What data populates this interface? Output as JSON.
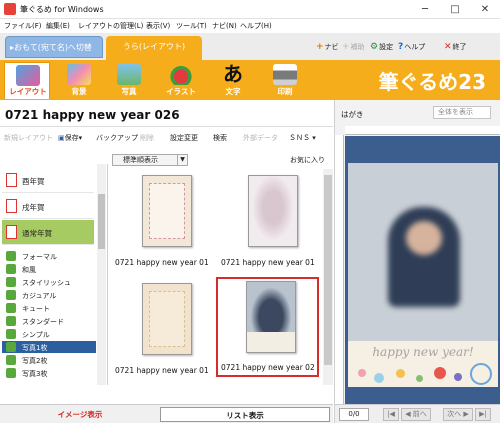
{
  "window": {
    "title": "筆ぐるめ for Windows",
    "controls": {
      "minimize": "─",
      "maximize": "□",
      "close": "✕"
    }
  },
  "menubar": {
    "items": [
      "ファイル(F)",
      "編集(E)",
      "レイアウトの管理(L)",
      "表示(V)",
      "ツール(T)",
      "ナビ(N)",
      "ヘルプ(H)"
    ]
  },
  "side_tabs": {
    "omote": "▸おもて(宛て名)へ切替",
    "ura": "うら(レイアウト)"
  },
  "help_links": {
    "navi": {
      "glyph": "+",
      "label": "ナビ"
    },
    "hojo": {
      "glyph": "+",
      "label": "補助"
    },
    "settings": {
      "glyph": "⚙",
      "label": "設定"
    },
    "help": {
      "glyph": "?",
      "label": "ヘルプ"
    },
    "exit": {
      "glyph": "✕",
      "label": "終了"
    }
  },
  "ribbon": {
    "buttons": [
      "レイアウト",
      "背景",
      "写真",
      "イラスト",
      "文字",
      "印刷"
    ],
    "active_index": 0,
    "brand": "筆ぐるめ23",
    "accent": "#f6ad1c"
  },
  "document": {
    "title": "0721  happy new year  026"
  },
  "toolbar": {
    "new_layout": "新規レイアウト",
    "save": "保存",
    "backup": "バックアップ",
    "delete": "削除",
    "change_settings": "設定変更",
    "search": "検索",
    "external_data": "外部データ",
    "sns": "ＳＮＳ"
  },
  "sort": {
    "selected": "標準順表示",
    "favorites": "お気に入り"
  },
  "categories": [
    {
      "label": "酉年賀",
      "selected": false
    },
    {
      "label": "戌年賀",
      "selected": false
    },
    {
      "label": "通常年賀",
      "selected": true
    }
  ],
  "subcategories": [
    {
      "label": "フォーマル",
      "selected": false
    },
    {
      "label": "和風",
      "selected": false
    },
    {
      "label": "スタイリッシュ",
      "selected": false
    },
    {
      "label": "カジュアル",
      "selected": false
    },
    {
      "label": "キュート",
      "selected": false
    },
    {
      "label": "スタンダード",
      "selected": false
    },
    {
      "label": "シンプル",
      "selected": false
    },
    {
      "label": "写真1枚",
      "selected": true
    },
    {
      "label": "写真2枚",
      "selected": false
    },
    {
      "label": "写真3枚",
      "selected": false
    }
  ],
  "thumbnails": [
    {
      "caption": "0721  happy new year  01",
      "kind": "frame",
      "selected": false
    },
    {
      "caption": "0721  happy new year  01",
      "kind": "photo",
      "selected": false
    },
    {
      "caption": "0721  happy new year  01",
      "kind": "frame",
      "selected": false
    },
    {
      "caption": "0721  happy new year  02",
      "kind": "photo",
      "selected": true
    }
  ],
  "view_tabs": {
    "image": "イメージ表示",
    "list": "リスト表示"
  },
  "preview": {
    "paper": "はがき",
    "zoom": "全体を表示",
    "card_text": "happy new year!",
    "page_counter": "0/0",
    "first": "|◀",
    "prev": "◀ 前へ",
    "next": "次へ ▶",
    "last": "▶|"
  }
}
